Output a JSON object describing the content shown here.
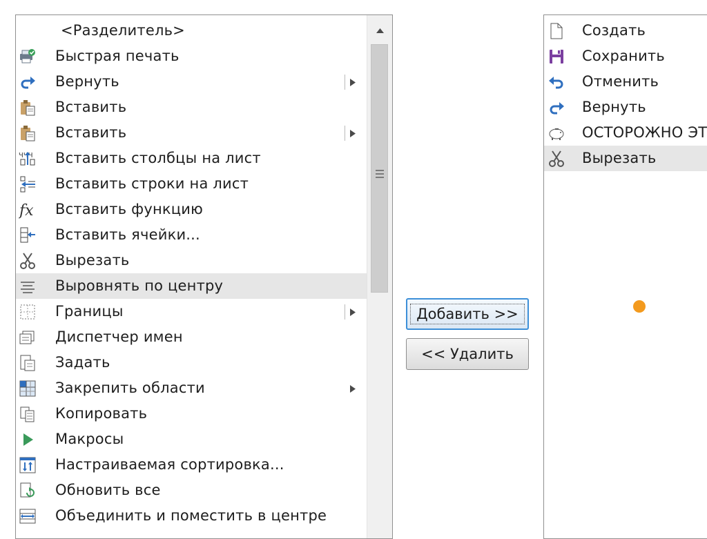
{
  "left_list": {
    "items": [
      {
        "label": "<Разделитель>",
        "icon": "none",
        "center": true
      },
      {
        "label": "Быстрая печать",
        "icon": "quick-print-icon"
      },
      {
        "label": "Вернуть",
        "icon": "redo-icon",
        "submenu": true
      },
      {
        "label": "Вставить",
        "icon": "paste-icon"
      },
      {
        "label": "Вставить",
        "icon": "paste-icon",
        "submenu": true
      },
      {
        "label": "Вставить столбцы на лист",
        "icon": "insert-columns-icon"
      },
      {
        "label": "Вставить строки на лист",
        "icon": "insert-rows-icon"
      },
      {
        "label": "Вставить функцию",
        "icon": "function-icon"
      },
      {
        "label": "Вставить ячейки...",
        "icon": "insert-cells-icon"
      },
      {
        "label": "Вырезать",
        "icon": "scissors-icon"
      },
      {
        "label": "Выровнять по центру",
        "icon": "align-center-icon",
        "selected": true
      },
      {
        "label": "Границы",
        "icon": "borders-icon",
        "submenu": true
      },
      {
        "label": "Диспетчер имен",
        "icon": "name-manager-icon"
      },
      {
        "label": "Задать",
        "icon": "set-icon"
      },
      {
        "label": "Закрепить области",
        "icon": "freeze-panes-icon",
        "submenu": true,
        "nosep": true
      },
      {
        "label": "Копировать",
        "icon": "copy-icon"
      },
      {
        "label": "Макросы",
        "icon": "macros-icon"
      },
      {
        "label": "Настраиваемая сортировка...",
        "icon": "custom-sort-icon"
      },
      {
        "label": "Обновить все",
        "icon": "refresh-all-icon"
      },
      {
        "label": "Объединить и поместить в центре",
        "icon": "merge-center-icon"
      }
    ]
  },
  "right_list": {
    "items": [
      {
        "label": "Создать",
        "icon": "new-document-icon"
      },
      {
        "label": "Сохранить",
        "icon": "save-icon"
      },
      {
        "label": "Отменить",
        "icon": "undo-icon"
      },
      {
        "label": "Вернуть",
        "icon": "redo-icon"
      },
      {
        "label": "ОСТОРОЖНО ЭТ",
        "icon": "piggy-bank-icon"
      },
      {
        "label": "Вырезать",
        "icon": "scissors-icon",
        "selected": true
      }
    ]
  },
  "buttons": {
    "add": "Добавить >>",
    "remove": "<< Удалить"
  },
  "colors": {
    "selection": "#e6e6e6",
    "accent_border": "#3c8fd8",
    "orange_dot": "#f39a1e"
  }
}
